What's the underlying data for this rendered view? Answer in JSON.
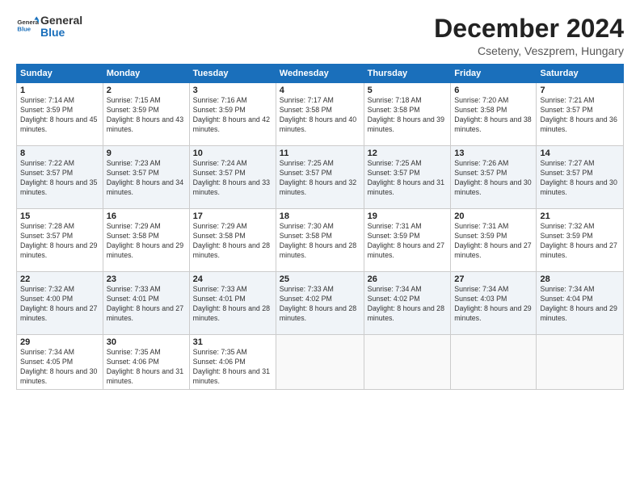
{
  "logo": {
    "text_general": "General",
    "text_blue": "Blue"
  },
  "header": {
    "month": "December 2024",
    "location": "Cseteny, Veszprem, Hungary"
  },
  "weekdays": [
    "Sunday",
    "Monday",
    "Tuesday",
    "Wednesday",
    "Thursday",
    "Friday",
    "Saturday"
  ],
  "weeks": [
    [
      {
        "day": "1",
        "sunrise": "7:14 AM",
        "sunset": "3:59 PM",
        "daylight": "8 hours and 45 minutes."
      },
      {
        "day": "2",
        "sunrise": "7:15 AM",
        "sunset": "3:59 PM",
        "daylight": "8 hours and 43 minutes."
      },
      {
        "day": "3",
        "sunrise": "7:16 AM",
        "sunset": "3:59 PM",
        "daylight": "8 hours and 42 minutes."
      },
      {
        "day": "4",
        "sunrise": "7:17 AM",
        "sunset": "3:58 PM",
        "daylight": "8 hours and 40 minutes."
      },
      {
        "day": "5",
        "sunrise": "7:18 AM",
        "sunset": "3:58 PM",
        "daylight": "8 hours and 39 minutes."
      },
      {
        "day": "6",
        "sunrise": "7:20 AM",
        "sunset": "3:58 PM",
        "daylight": "8 hours and 38 minutes."
      },
      {
        "day": "7",
        "sunrise": "7:21 AM",
        "sunset": "3:57 PM",
        "daylight": "8 hours and 36 minutes."
      }
    ],
    [
      {
        "day": "8",
        "sunrise": "7:22 AM",
        "sunset": "3:57 PM",
        "daylight": "8 hours and 35 minutes."
      },
      {
        "day": "9",
        "sunrise": "7:23 AM",
        "sunset": "3:57 PM",
        "daylight": "8 hours and 34 minutes."
      },
      {
        "day": "10",
        "sunrise": "7:24 AM",
        "sunset": "3:57 PM",
        "daylight": "8 hours and 33 minutes."
      },
      {
        "day": "11",
        "sunrise": "7:25 AM",
        "sunset": "3:57 PM",
        "daylight": "8 hours and 32 minutes."
      },
      {
        "day": "12",
        "sunrise": "7:25 AM",
        "sunset": "3:57 PM",
        "daylight": "8 hours and 31 minutes."
      },
      {
        "day": "13",
        "sunrise": "7:26 AM",
        "sunset": "3:57 PM",
        "daylight": "8 hours and 30 minutes."
      },
      {
        "day": "14",
        "sunrise": "7:27 AM",
        "sunset": "3:57 PM",
        "daylight": "8 hours and 30 minutes."
      }
    ],
    [
      {
        "day": "15",
        "sunrise": "7:28 AM",
        "sunset": "3:57 PM",
        "daylight": "8 hours and 29 minutes."
      },
      {
        "day": "16",
        "sunrise": "7:29 AM",
        "sunset": "3:58 PM",
        "daylight": "8 hours and 29 minutes."
      },
      {
        "day": "17",
        "sunrise": "7:29 AM",
        "sunset": "3:58 PM",
        "daylight": "8 hours and 28 minutes."
      },
      {
        "day": "18",
        "sunrise": "7:30 AM",
        "sunset": "3:58 PM",
        "daylight": "8 hours and 28 minutes."
      },
      {
        "day": "19",
        "sunrise": "7:31 AM",
        "sunset": "3:59 PM",
        "daylight": "8 hours and 27 minutes."
      },
      {
        "day": "20",
        "sunrise": "7:31 AM",
        "sunset": "3:59 PM",
        "daylight": "8 hours and 27 minutes."
      },
      {
        "day": "21",
        "sunrise": "7:32 AM",
        "sunset": "3:59 PM",
        "daylight": "8 hours and 27 minutes."
      }
    ],
    [
      {
        "day": "22",
        "sunrise": "7:32 AM",
        "sunset": "4:00 PM",
        "daylight": "8 hours and 27 minutes."
      },
      {
        "day": "23",
        "sunrise": "7:33 AM",
        "sunset": "4:01 PM",
        "daylight": "8 hours and 27 minutes."
      },
      {
        "day": "24",
        "sunrise": "7:33 AM",
        "sunset": "4:01 PM",
        "daylight": "8 hours and 28 minutes."
      },
      {
        "day": "25",
        "sunrise": "7:33 AM",
        "sunset": "4:02 PM",
        "daylight": "8 hours and 28 minutes."
      },
      {
        "day": "26",
        "sunrise": "7:34 AM",
        "sunset": "4:02 PM",
        "daylight": "8 hours and 28 minutes."
      },
      {
        "day": "27",
        "sunrise": "7:34 AM",
        "sunset": "4:03 PM",
        "daylight": "8 hours and 29 minutes."
      },
      {
        "day": "28",
        "sunrise": "7:34 AM",
        "sunset": "4:04 PM",
        "daylight": "8 hours and 29 minutes."
      }
    ],
    [
      {
        "day": "29",
        "sunrise": "7:34 AM",
        "sunset": "4:05 PM",
        "daylight": "8 hours and 30 minutes."
      },
      {
        "day": "30",
        "sunrise": "7:35 AM",
        "sunset": "4:06 PM",
        "daylight": "8 hours and 31 minutes."
      },
      {
        "day": "31",
        "sunrise": "7:35 AM",
        "sunset": "4:06 PM",
        "daylight": "8 hours and 31 minutes."
      },
      null,
      null,
      null,
      null
    ]
  ]
}
